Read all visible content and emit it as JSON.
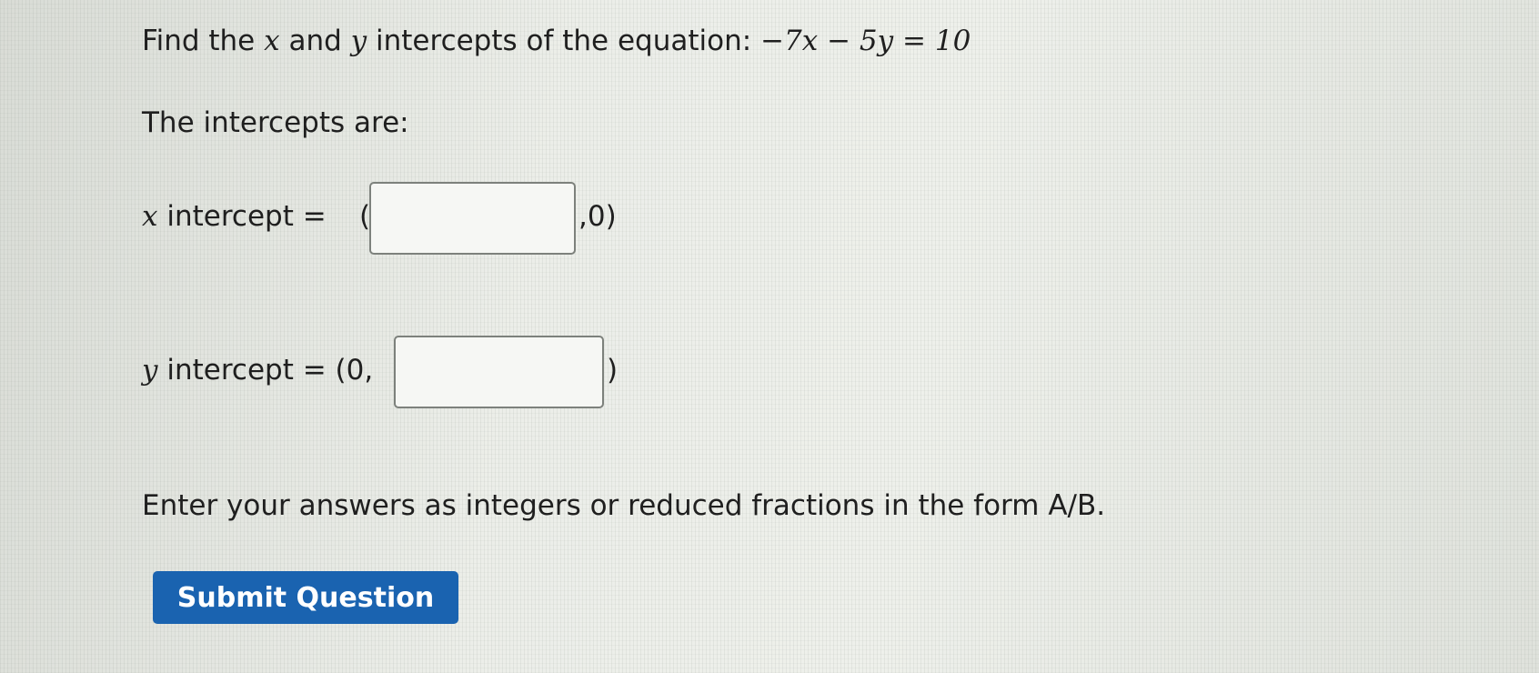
{
  "question": {
    "prefix": "Find the",
    "var_x": "x",
    "and": "and",
    "var_y": "y",
    "suffix": "intercepts of the equation:",
    "equation": "−7x − 5y = 10"
  },
  "intercepts_heading": "The intercepts are:",
  "x_intercept": {
    "var": "x",
    "label": "intercept = ",
    "open": "(",
    "close": ",0)",
    "value": ""
  },
  "y_intercept": {
    "var": "y",
    "label": "intercept = (0,",
    "close": ")",
    "value": ""
  },
  "instructions": "Enter your answers as integers or reduced fractions in the form A/B.",
  "submit_label": "Submit Question",
  "colors": {
    "button_bg": "#1a63b0",
    "button_text": "#ffffff"
  }
}
